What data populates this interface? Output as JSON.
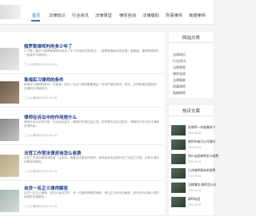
{
  "nav": {
    "items": [
      "首页",
      "法律知识",
      "行业资讯",
      "法律课堂",
      "律师咨询",
      "法律援助",
      "刑事律师",
      "离婚律师"
    ]
  },
  "articles": [
    {
      "title": "俄罗斯律师判刑多少年了",
      "excerpt": "以下是一篇关于俄罗斯律师判刑多少年了的相关文章资讯：（俄罗斯律师判刑年限）据报道，俄罗斯律师在一起案件中被判刑...",
      "meta": "三六九律师网 2020-05-08"
    },
    {
      "title": "珠海实习律师的条件",
      "excerpt": "珠海实习律师的条件：在珠海，成为一名实习律师需要满足一系列严格的条件。首先，必须是通过国家统一法律职业资格考试...",
      "meta": "三六九律师网 2020-05-08"
    },
    {
      "title": "律师在诉讼中的作用是什么",
      "excerpt": "律师在诉讼中的作用：在法治社会中，律师的作用日益凸显，特别是在诉讼过程中。律师作为专业的法律服务提供者...",
      "meta": "三六九律师网 2020-05-08"
    },
    {
      "title": "法官工作室法律咨询怎么收费",
      "excerpt": "法官工作室法律咨询收费：近年来，随着法治建设的推进，越来越多的法院开设了法官工作室，为群众提供法律咨询服务...",
      "meta": "三六九律师网 2020-05-08"
    },
    {
      "title": "自贡一名正义律师解答",
      "excerpt": "自贡一名正义律师：在四川省自贡市，有一位备受尊敬的律师，他以正义和专业著称，多年来为当事人提供优质的法律服务...",
      "meta": "三六九律师网 2020-05-08"
    }
  ],
  "sidebar": {
    "categories_title": "网站分类",
    "categories": [
      "法律知识",
      "行业资讯",
      "法律课堂",
      "律师咨询",
      "法律援助",
      "刑事律师",
      "离婚律师"
    ],
    "hot_title": "热评文章",
    "hot": [
      {
        "title": "先律师一年能赚多少",
        "date": "2020-05-08"
      },
      {
        "title": "律师作者可以代理吗",
        "date": "2020-05-08"
      },
      {
        "title": "四川出庭律师怎么收费",
        "date": "2020-05-08"
      },
      {
        "title": "江苏律师事务所收费",
        "date": "2020-05-08"
      },
      {
        "title": "法律事务,律师怎么办",
        "date": "2020-05-08"
      },
      {
        "title": "律师欢迎",
        "date": "2020-05-08"
      }
    ]
  }
}
